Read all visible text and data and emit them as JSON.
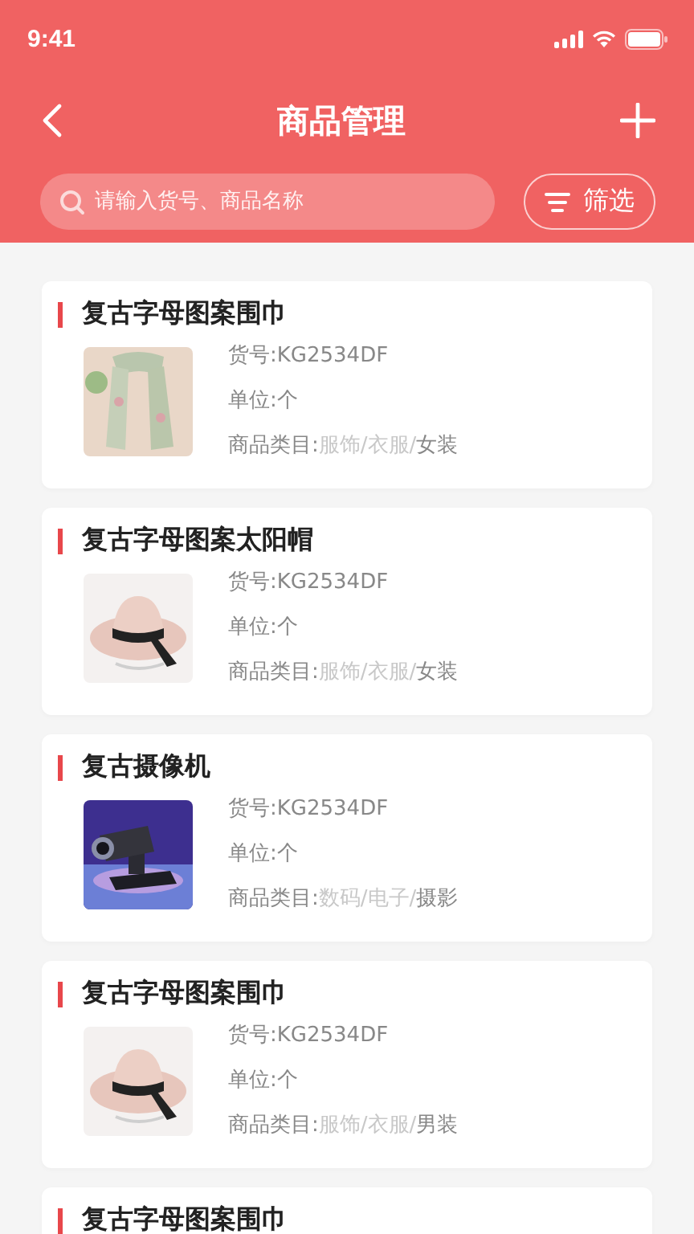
{
  "status_bar": {
    "time": "9:41"
  },
  "nav": {
    "title": "商品管理"
  },
  "search": {
    "placeholder": "请输入货号、商品名称"
  },
  "filter_button": {
    "label": "筛选"
  },
  "products": [
    {
      "name": "复古字母图案围巾",
      "kind": "picture",
      "sku": "货号:KG2534DF",
      "unit": "单位:个",
      "category_label": "商品类目:",
      "category": "服饰/衣服/女装"
    },
    {
      "name": "复古字母图案太阳帽",
      "kind": "picture",
      "sku": "货号:KG2534DF",
      "unit": "单位:个",
      "category_label": "商品类目:",
      "category": "服饰/衣服/女装"
    },
    {
      "name": "复古摄像机",
      "kind": "picture",
      "sku": "货号:KG2534DF",
      "unit": "单位:个",
      "category_label": "商品类目:",
      "category": "数码/电子/摄影"
    },
    {
      "name": "复古字母图案围巾",
      "kind": "picture",
      "sku": "货号:KG2534DF",
      "unit": "单位:个",
      "category_label": "商品类目:",
      "category": "服饰/衣服/男装"
    },
    {
      "name": "复古字母图案围巾"
    }
  ]
}
